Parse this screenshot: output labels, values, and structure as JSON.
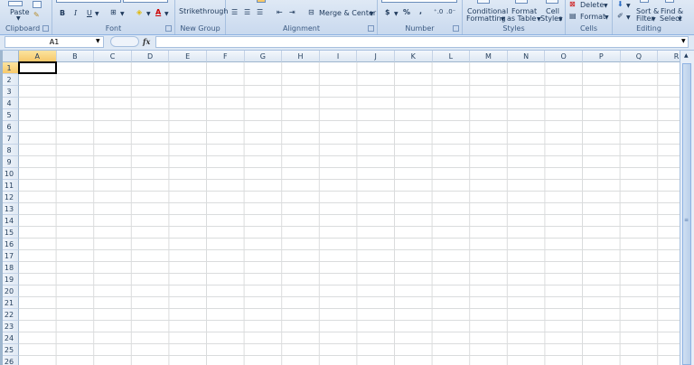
{
  "ribbon": {
    "clipboard": {
      "label": "Clipboard",
      "paste": "Paste"
    },
    "font": {
      "label": "Font",
      "bold": "B",
      "italic": "I",
      "underline": "U",
      "font_color": "A"
    },
    "new_group": {
      "label": "New Group",
      "strikethrough": "Strikethrough"
    },
    "alignment": {
      "label": "Alignment",
      "merge_center": "Merge & Center"
    },
    "number": {
      "label": "Number",
      "currency": "$",
      "percent": "%",
      "comma": ","
    },
    "styles": {
      "label": "Styles",
      "conditional_1": "Conditional",
      "conditional_2": "Formatting",
      "format_table_1": "Format",
      "format_table_2": "as Table",
      "cell_styles_1": "Cell",
      "cell_styles_2": "Styles"
    },
    "cells": {
      "label": "Cells",
      "delete": "Delete",
      "format": "Format"
    },
    "editing": {
      "label": "Editing",
      "sort_1": "Sort &",
      "sort_2": "Filter",
      "find_1": "Find &",
      "find_2": "Select"
    }
  },
  "formula_bar": {
    "name_box": "A1",
    "fx": "fx",
    "value": ""
  },
  "sheet": {
    "columns": [
      "A",
      "B",
      "C",
      "D",
      "E",
      "F",
      "G",
      "H",
      "I",
      "J",
      "K",
      "L",
      "M",
      "N",
      "O",
      "P",
      "Q",
      "R"
    ],
    "rows": [
      "1",
      "2",
      "3",
      "4",
      "5",
      "6",
      "7",
      "8",
      "9",
      "10",
      "11",
      "12",
      "13",
      "14",
      "15",
      "16",
      "17",
      "18",
      "19",
      "20",
      "21",
      "22",
      "23",
      "24",
      "25",
      "26"
    ],
    "selected_cell": "A1"
  },
  "colors": {
    "accent": "#f7c96a",
    "ribbon": "#dfe9f5",
    "grid_line": "#dadcdd"
  }
}
